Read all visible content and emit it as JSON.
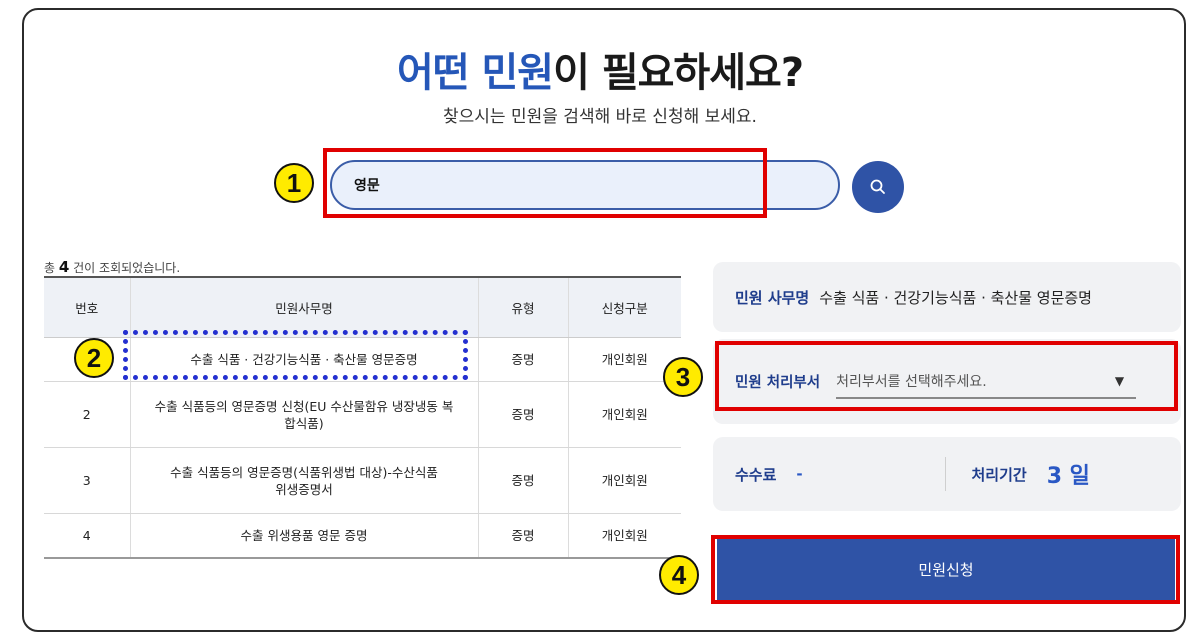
{
  "header": {
    "title_accent_1": "어떤",
    "title_accent_2": "민원",
    "title_rest_1": " ",
    "title_rest_2": "이 필요하세요?",
    "subtitle": "찾으시는 민원을 검색해 바로 신청해 보세요."
  },
  "search": {
    "value": "영문",
    "button_icon": "search-icon"
  },
  "results": {
    "count_prefix": "총",
    "count": "4",
    "count_suffix": "건이 조회되었습니다.",
    "columns": [
      "번호",
      "민원사무명",
      "유형",
      "신청구분"
    ],
    "rows": [
      {
        "no": "",
        "name": "수출 식품 · 건강기능식품 · 축산물 영문증명",
        "type": "증명",
        "applicant": "개인회원"
      },
      {
        "no": "2",
        "name": "수출 식품등의 영문증명 신청(EU 수산물함유 냉장냉동 복합식품)",
        "type": "증명",
        "applicant": "개인회원"
      },
      {
        "no": "3",
        "name": "수출 식품등의 영문증명(식품위생법 대상)-수산식품위생증명서",
        "type": "증명",
        "applicant": "개인회원"
      },
      {
        "no": "4",
        "name": "수출 위생용품 영문 증명",
        "type": "증명",
        "applicant": "개인회원"
      }
    ]
  },
  "detail": {
    "name_label": "민원 사무명",
    "name_value": "수출 식품 · 건강기능식품 · 축산물 영문증명",
    "dept_label": "민원 처리부서",
    "dept_placeholder": "처리부서를 선택해주세요.",
    "fee_label": "수수료",
    "fee_value": "-",
    "period_label": "처리기간",
    "period_value": "3 일"
  },
  "apply_button": "민원신청",
  "annotations": {
    "step1": "1",
    "step2": "2",
    "step3": "3",
    "step4": "4",
    "highlight_color": "#e00000",
    "dotted_color": "#2430d0",
    "badge_color": "#ffeb00"
  },
  "colors": {
    "accent": "#2557b8",
    "button": "#2f53a6",
    "label": "#1f3d8c"
  }
}
